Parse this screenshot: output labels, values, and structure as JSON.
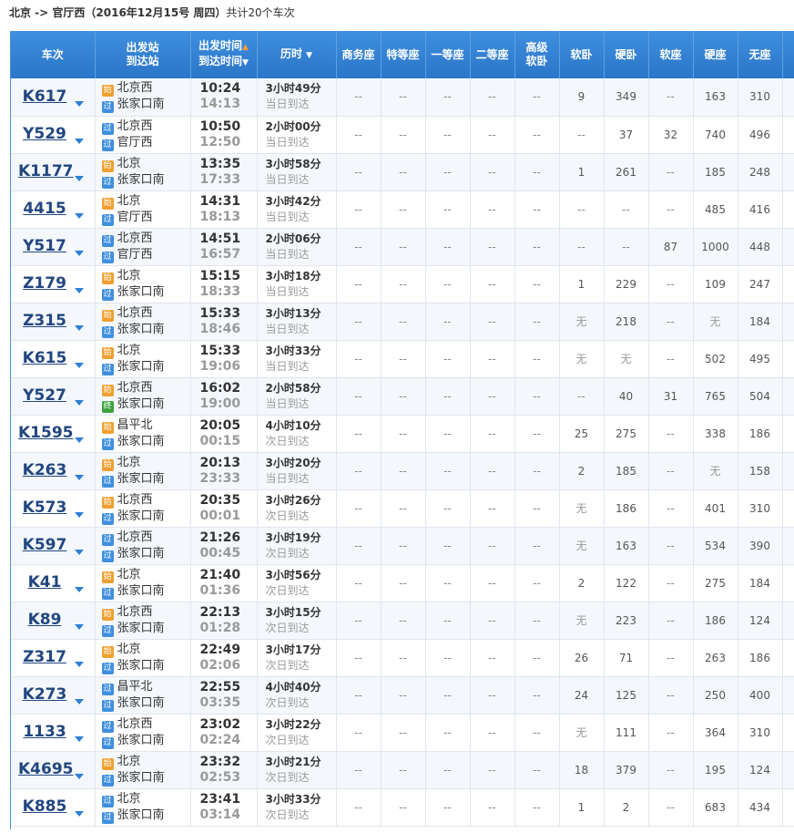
{
  "caption": {
    "route": "北京 -> 官厅西",
    "date": "（2016年12月15号  周四）",
    "total": "共计20个车次"
  },
  "headers": {
    "train": "车次",
    "stations_top": "出发站",
    "stations_bottom": "到达站",
    "times_top": "出发时间",
    "times_bottom": "到达时间",
    "duration": "历时",
    "business": "商务座",
    "special": "特等座",
    "first": "一等座",
    "second": "二等座",
    "senior_top": "高级",
    "senior_bottom": "软卧",
    "soft_sleeper": "软卧",
    "hard_sleeper": "硬卧",
    "soft_seat": "软座",
    "hard_seat": "硬座",
    "no_seat": "无座"
  },
  "tag_labels": {
    "start": "始",
    "pass": "过",
    "end": "终"
  },
  "rows": [
    {
      "train": "K617",
      "from": "北京西",
      "from_tag": "start",
      "to": "张家口南",
      "to_tag": "pass",
      "dep": "10:24",
      "arr": "14:13",
      "dur": "3小时49分",
      "day": "当日到达",
      "seats": [
        "--",
        "--",
        "--",
        "--",
        "--",
        "9",
        "349",
        "--",
        "163",
        "310"
      ]
    },
    {
      "train": "Y529",
      "from": "北京西",
      "from_tag": "pass",
      "to": "官厅西",
      "to_tag": "pass",
      "dep": "10:50",
      "arr": "12:50",
      "dur": "2小时00分",
      "day": "当日到达",
      "seats": [
        "--",
        "--",
        "--",
        "--",
        "--",
        "--",
        "37",
        "32",
        "740",
        "496"
      ]
    },
    {
      "train": "K1177",
      "from": "北京",
      "from_tag": "start",
      "to": "张家口南",
      "to_tag": "pass",
      "dep": "13:35",
      "arr": "17:33",
      "dur": "3小时58分",
      "day": "当日到达",
      "seats": [
        "--",
        "--",
        "--",
        "--",
        "--",
        "1",
        "261",
        "--",
        "185",
        "248"
      ]
    },
    {
      "train": "4415",
      "from": "北京",
      "from_tag": "start",
      "to": "官厅西",
      "to_tag": "pass",
      "dep": "14:31",
      "arr": "18:13",
      "dur": "3小时42分",
      "day": "当日到达",
      "seats": [
        "--",
        "--",
        "--",
        "--",
        "--",
        "--",
        "--",
        "--",
        "485",
        "416"
      ]
    },
    {
      "train": "Y517",
      "from": "北京西",
      "from_tag": "pass",
      "to": "官厅西",
      "to_tag": "pass",
      "dep": "14:51",
      "arr": "16:57",
      "dur": "2小时06分",
      "day": "当日到达",
      "seats": [
        "--",
        "--",
        "--",
        "--",
        "--",
        "--",
        "--",
        "87",
        "1000",
        "448"
      ]
    },
    {
      "train": "Z179",
      "from": "北京",
      "from_tag": "start",
      "to": "张家口南",
      "to_tag": "pass",
      "dep": "15:15",
      "arr": "18:33",
      "dur": "3小时18分",
      "day": "当日到达",
      "seats": [
        "--",
        "--",
        "--",
        "--",
        "--",
        "1",
        "229",
        "--",
        "109",
        "247"
      ]
    },
    {
      "train": "Z315",
      "from": "北京西",
      "from_tag": "start",
      "to": "张家口南",
      "to_tag": "pass",
      "dep": "15:33",
      "arr": "18:46",
      "dur": "3小时13分",
      "day": "当日到达",
      "seats": [
        "--",
        "--",
        "--",
        "--",
        "--",
        "无",
        "218",
        "--",
        "无",
        "184"
      ]
    },
    {
      "train": "K615",
      "from": "北京",
      "from_tag": "start",
      "to": "张家口南",
      "to_tag": "pass",
      "dep": "15:33",
      "arr": "19:06",
      "dur": "3小时33分",
      "day": "当日到达",
      "seats": [
        "--",
        "--",
        "--",
        "--",
        "--",
        "无",
        "无",
        "--",
        "502",
        "495"
      ]
    },
    {
      "train": "Y527",
      "from": "北京西",
      "from_tag": "start",
      "to": "张家口南",
      "to_tag": "end",
      "dep": "16:02",
      "arr": "19:00",
      "dur": "2小时58分",
      "day": "当日到达",
      "seats": [
        "--",
        "--",
        "--",
        "--",
        "--",
        "--",
        "40",
        "31",
        "765",
        "504"
      ]
    },
    {
      "train": "K1595",
      "from": "昌平北",
      "from_tag": "start",
      "to": "张家口南",
      "to_tag": "pass",
      "dep": "20:05",
      "arr": "00:15",
      "dur": "4小时10分",
      "day": "次日到达",
      "seats": [
        "--",
        "--",
        "--",
        "--",
        "--",
        "25",
        "275",
        "--",
        "338",
        "186"
      ]
    },
    {
      "train": "K263",
      "from": "北京",
      "from_tag": "start",
      "to": "张家口南",
      "to_tag": "pass",
      "dep": "20:13",
      "arr": "23:33",
      "dur": "3小时20分",
      "day": "当日到达",
      "seats": [
        "--",
        "--",
        "--",
        "--",
        "--",
        "2",
        "185",
        "--",
        "无",
        "158"
      ]
    },
    {
      "train": "K573",
      "from": "北京西",
      "from_tag": "start",
      "to": "张家口南",
      "to_tag": "pass",
      "dep": "20:35",
      "arr": "00:01",
      "dur": "3小时26分",
      "day": "次日到达",
      "seats": [
        "--",
        "--",
        "--",
        "--",
        "--",
        "无",
        "186",
        "--",
        "401",
        "310"
      ]
    },
    {
      "train": "K597",
      "from": "北京西",
      "from_tag": "pass",
      "to": "张家口南",
      "to_tag": "pass",
      "dep": "21:26",
      "arr": "00:45",
      "dur": "3小时19分",
      "day": "次日到达",
      "seats": [
        "--",
        "--",
        "--",
        "--",
        "--",
        "无",
        "163",
        "--",
        "534",
        "390"
      ]
    },
    {
      "train": "K41",
      "from": "北京",
      "from_tag": "start",
      "to": "张家口南",
      "to_tag": "pass",
      "dep": "21:40",
      "arr": "01:36",
      "dur": "3小时56分",
      "day": "次日到达",
      "seats": [
        "--",
        "--",
        "--",
        "--",
        "--",
        "2",
        "122",
        "--",
        "275",
        "184"
      ]
    },
    {
      "train": "K89",
      "from": "北京西",
      "from_tag": "start",
      "to": "张家口南",
      "to_tag": "pass",
      "dep": "22:13",
      "arr": "01:28",
      "dur": "3小时15分",
      "day": "次日到达",
      "seats": [
        "--",
        "--",
        "--",
        "--",
        "--",
        "无",
        "223",
        "--",
        "186",
        "124"
      ]
    },
    {
      "train": "Z317",
      "from": "北京",
      "from_tag": "start",
      "to": "张家口南",
      "to_tag": "pass",
      "dep": "22:49",
      "arr": "02:06",
      "dur": "3小时17分",
      "day": "次日到达",
      "seats": [
        "--",
        "--",
        "--",
        "--",
        "--",
        "26",
        "71",
        "--",
        "263",
        "186"
      ]
    },
    {
      "train": "K273",
      "from": "昌平北",
      "from_tag": "pass",
      "to": "张家口南",
      "to_tag": "pass",
      "dep": "22:55",
      "arr": "03:35",
      "dur": "4小时40分",
      "day": "次日到达",
      "seats": [
        "--",
        "--",
        "--",
        "--",
        "--",
        "24",
        "125",
        "--",
        "250",
        "400"
      ]
    },
    {
      "train": "1133",
      "from": "北京西",
      "from_tag": "pass",
      "to": "张家口南",
      "to_tag": "pass",
      "dep": "23:02",
      "arr": "02:24",
      "dur": "3小时22分",
      "day": "次日到达",
      "seats": [
        "--",
        "--",
        "--",
        "--",
        "--",
        "无",
        "111",
        "--",
        "364",
        "310"
      ]
    },
    {
      "train": "K4695",
      "from": "北京",
      "from_tag": "start",
      "to": "张家口南",
      "to_tag": "pass",
      "dep": "23:32",
      "arr": "02:53",
      "dur": "3小时21分",
      "day": "次日到达",
      "seats": [
        "--",
        "--",
        "--",
        "--",
        "--",
        "18",
        "379",
        "--",
        "195",
        "124"
      ]
    },
    {
      "train": "K885",
      "from": "北京",
      "from_tag": "pass",
      "to": "张家口南",
      "to_tag": "pass",
      "dep": "23:41",
      "arr": "03:14",
      "dur": "3小时33分",
      "day": "次日到达",
      "seats": [
        "--",
        "--",
        "--",
        "--",
        "--",
        "1",
        "2",
        "--",
        "683",
        "434"
      ]
    }
  ],
  "colors": {
    "header_bg": "#2a75c7",
    "train_link": "#224680",
    "start_tag": "#f0a030",
    "pass_tag": "#3f8fe0",
    "end_tag": "#3aa33a",
    "sort_active": "#ff9a3a"
  }
}
